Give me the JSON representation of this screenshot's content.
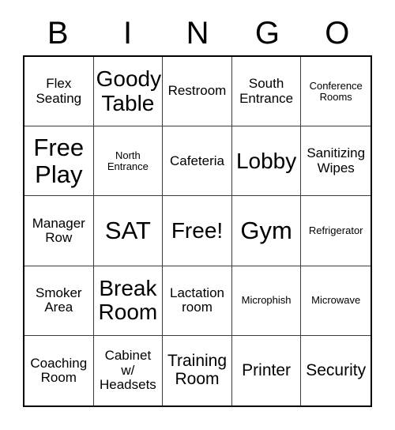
{
  "header": {
    "letters": [
      "B",
      "I",
      "N",
      "G",
      "O"
    ]
  },
  "grid": {
    "rows": 5,
    "columns": 5,
    "cells": [
      {
        "text": "Flex\nSeating",
        "size": "sm"
      },
      {
        "text": "Goody\nTable",
        "size": "lg"
      },
      {
        "text": "Restroom",
        "size": "sm"
      },
      {
        "text": "South\nEntrance",
        "size": "sm"
      },
      {
        "text": "Conference\nRooms",
        "size": "xs"
      },
      {
        "text": "Free\nPlay",
        "size": "xl"
      },
      {
        "text": "North\nEntrance",
        "size": "xs"
      },
      {
        "text": "Cafeteria",
        "size": "sm"
      },
      {
        "text": "Lobby",
        "size": "lg"
      },
      {
        "text": "Sanitizing\nWipes",
        "size": "sm"
      },
      {
        "text": "Manager\nRow",
        "size": "sm"
      },
      {
        "text": "SAT",
        "size": "xl"
      },
      {
        "text": "Free!",
        "size": "lg"
      },
      {
        "text": "Gym",
        "size": "xl"
      },
      {
        "text": "Refrigerator",
        "size": "xs"
      },
      {
        "text": "Smoker\nArea",
        "size": "sm"
      },
      {
        "text": "Break\nRoom",
        "size": "lg"
      },
      {
        "text": "Lactation\nroom",
        "size": "sm"
      },
      {
        "text": "Microphish",
        "size": "xs"
      },
      {
        "text": "Microwave",
        "size": "xs"
      },
      {
        "text": "Coaching\nRoom",
        "size": "sm"
      },
      {
        "text": "Cabinet\nw/\nHeadsets",
        "size": "sm"
      },
      {
        "text": "Training\nRoom",
        "size": "md"
      },
      {
        "text": "Printer",
        "size": "md"
      },
      {
        "text": "Security",
        "size": "md"
      }
    ]
  },
  "colors": {
    "background": "#ffffff",
    "text": "#000000",
    "grid_line": "#3b3b3b",
    "outer_border": "#000000"
  }
}
